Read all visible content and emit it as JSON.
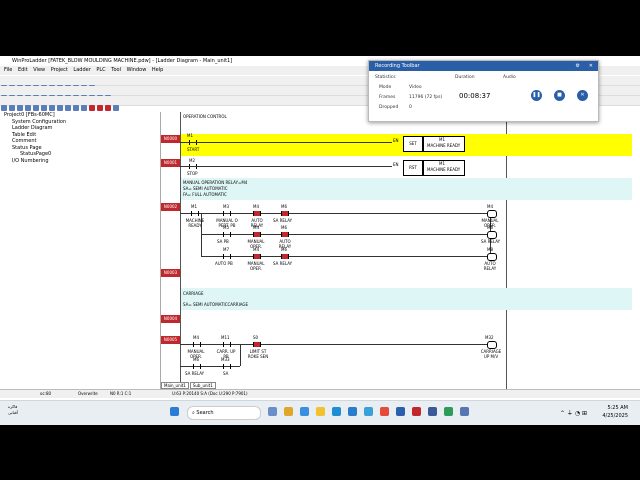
{
  "window": {
    "title": "WinProLadder [FATEK_BLOW MOULDING MACHINE.pdw] - [Ladder Diagram - Main_unit1]"
  },
  "menu": [
    "File",
    "Edit",
    "View",
    "Project",
    "Ladder",
    "PLC",
    "Tool",
    "Window",
    "Help"
  ],
  "tree": {
    "root": "Project0 [FBs-60MC]",
    "items": [
      "System Configuration",
      "Ladder Diagram",
      "Table Edit",
      "Comment",
      "Status Page",
      "StatusPage0",
      "I/O Numbering"
    ]
  },
  "ladder": {
    "rungs": [
      "N0000",
      "N0001",
      "N0002",
      "N0003",
      "N0004",
      "N0005"
    ],
    "comments": {
      "c1": "OPERATION CONTROL",
      "c2": "MANUAL OPERATION RELAY=M4",
      "c3": "SA= SEMI AUTOMATIC",
      "c4": "FA= FULL AUTOMATIC",
      "c5": "CARRIAGE",
      "c6": "SA= SEMI AUTOMATICCARRIAGE"
    },
    "labels": {
      "m1_top": "M1",
      "m1_sub": "START",
      "m2_top": "M2",
      "m2_sub": "STOP",
      "set": "SET",
      "rst": "RST",
      "en1": "EN",
      "en2": "EN",
      "coil_m1": "M1",
      "coil_m1_sub": "MACHINE READY",
      "coil_m1b": "M1",
      "coil_m1b_sub": "MACHINE READY",
      "r2c1": "M1",
      "r2c1s": "MACHINE READY",
      "r2c2": "M3",
      "r2c2s": "MANUAL O PERT. PB",
      "r2c3": "M4",
      "r2c3s": "AUTO RELAY",
      "r2c4": "M6",
      "r2c4s": "SA RELAY",
      "r2c5": "M5",
      "r2c5s": "SA PB",
      "r2c6": "M4",
      "r2c6s": "MANUAL OPER.",
      "r2c7": "M6",
      "r2c7s": "AUTO RELAY",
      "r2c8": "M7",
      "r2c8s": "AUTO PB",
      "r2c9": "M4",
      "r2c9s": "MANUAL OPER.",
      "r2c10": "M6",
      "r2c10s": "SA RELAY",
      "r2o1": "M4",
      "r2o1s": "MANUAL OPER.",
      "r2o2": "M6",
      "r2o2s": "SA RELAY",
      "r2o3": "M8",
      "r2o3s": "AUTO RELAY",
      "r5c1": "M4",
      "r5c1s": "MANUAL OPER.",
      "r5c2": "M11",
      "r5c2s": "CARR. UP PB",
      "r5c3": "S0",
      "r5c3s": "LIMIT ST ROKE SEN",
      "r5c4": "M6",
      "r5c4s": "SA RELAY",
      "r5c5": "M33",
      "r5c5s": "SA",
      "r5o1": "M32",
      "r5o1s": "CARRIAGE UP M/V"
    },
    "tabs": [
      "Main_unit1",
      "Sub_unit1"
    ]
  },
  "recorder": {
    "title": "Recording Toolbar",
    "statistics_label": "Statistics",
    "duration_label": "Duration",
    "audio_label": "Audio",
    "mode_label": "Mode",
    "mode_value": "Video",
    "frames_label": "Frames",
    "frames_value": "11796 (72 fps)",
    "dropped_label": "Dropped",
    "dropped_value": "0",
    "duration_value": "00:08:37"
  },
  "status": {
    "a": "oc:80",
    "b": "Overwrite",
    "c": "N0 R:1 C:1",
    "d": "U:63 P:20140 S:A (Doc U:290 P:7901)"
  },
  "taskbar": {
    "search": "Search",
    "time": "5:25 AM",
    "date": "4/25/2025",
    "lang1": "فاکره",
    "lang2": "آفتابی"
  },
  "colors": {
    "rung_marker": "#c0282d",
    "highlight": "#ffff00",
    "recorder_header": "#2a5fa8"
  }
}
